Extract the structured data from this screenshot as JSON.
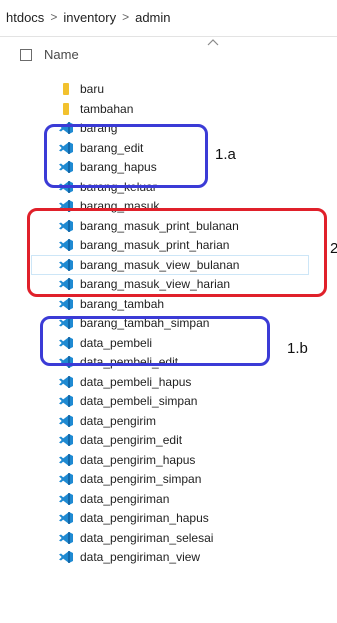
{
  "breadcrumb": [
    "htdocs",
    "inventory",
    "admin"
  ],
  "header": {
    "name_label": "Name"
  },
  "files": [
    {
      "name": "baru",
      "type": "folder"
    },
    {
      "name": "tambahan",
      "type": "folder"
    },
    {
      "name": "barang",
      "type": "vscode-file"
    },
    {
      "name": "barang_edit",
      "type": "vscode-file"
    },
    {
      "name": "barang_hapus",
      "type": "vscode-file"
    },
    {
      "name": "barang_keluar",
      "type": "vscode-file"
    },
    {
      "name": "barang_masuk",
      "type": "vscode-file"
    },
    {
      "name": "barang_masuk_print_bulanan",
      "type": "vscode-file"
    },
    {
      "name": "barang_masuk_print_harian",
      "type": "vscode-file"
    },
    {
      "name": "barang_masuk_view_bulanan",
      "type": "vscode-file",
      "selected": true
    },
    {
      "name": "barang_masuk_view_harian",
      "type": "vscode-file"
    },
    {
      "name": "barang_tambah",
      "type": "vscode-file"
    },
    {
      "name": "barang_tambah_simpan",
      "type": "vscode-file"
    },
    {
      "name": "data_pembeli",
      "type": "vscode-file"
    },
    {
      "name": "data_pembeli_edit",
      "type": "vscode-file"
    },
    {
      "name": "data_pembeli_hapus",
      "type": "vscode-file"
    },
    {
      "name": "data_pembeli_simpan",
      "type": "vscode-file"
    },
    {
      "name": "data_pengirim",
      "type": "vscode-file"
    },
    {
      "name": "data_pengirim_edit",
      "type": "vscode-file"
    },
    {
      "name": "data_pengirim_hapus",
      "type": "vscode-file"
    },
    {
      "name": "data_pengirim_simpan",
      "type": "vscode-file"
    },
    {
      "name": "data_pengiriman",
      "type": "vscode-file"
    },
    {
      "name": "data_pengiriman_hapus",
      "type": "vscode-file"
    },
    {
      "name": "data_pengiriman_selesai",
      "type": "vscode-file"
    },
    {
      "name": "data_pengiriman_view",
      "type": "vscode-file"
    }
  ],
  "annotations": [
    "1.a",
    "2",
    "1.b"
  ],
  "colors": {
    "folder": "#f2c12e",
    "vscode": "#1f8ad2",
    "blue_box": "#3b3bd6",
    "red_box": "#e0202a"
  }
}
